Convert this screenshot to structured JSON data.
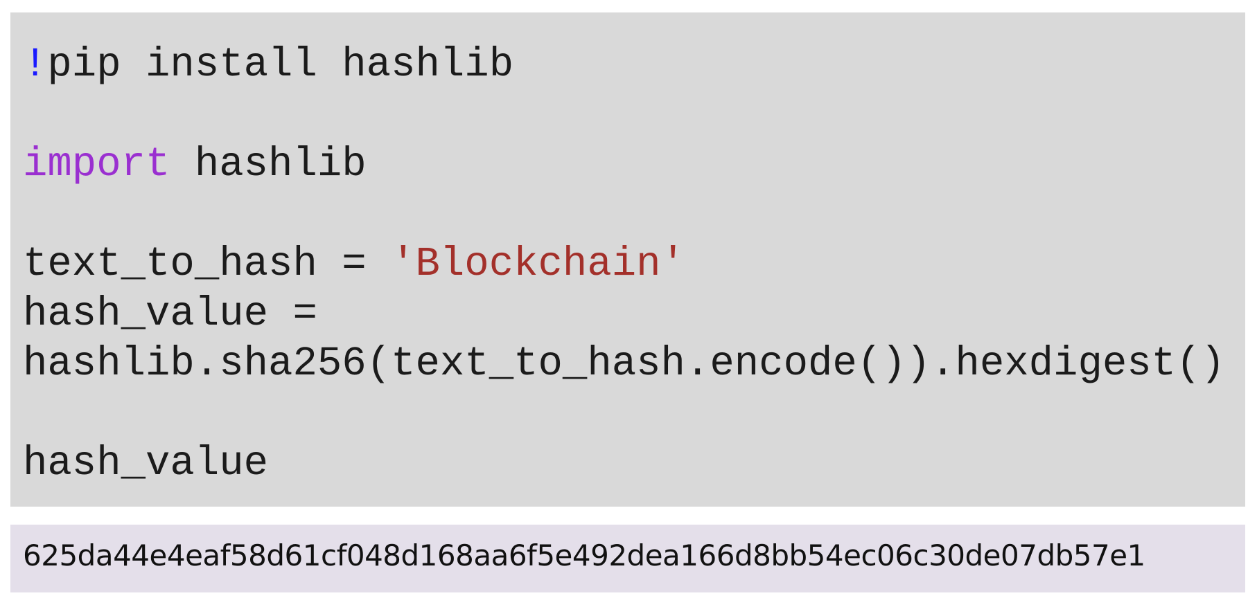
{
  "code_cell": {
    "line1_bang": "!",
    "line1_rest": "pip install hashlib",
    "line2_keyword": "import",
    "line2_rest": " hashlib",
    "line3_lhs": "text_to_hash = ",
    "line3_string": "'Blockchain'",
    "line4": "hash_value =",
    "line5": "hashlib.sha256(text_to_hash.encode()).hexdigest()",
    "line6": "hash_value"
  },
  "output_cell": {
    "text": "625da44e4eaf58d61cf048d168aa6f5e492dea166d8bb54ec06c30de07db57e1"
  },
  "colors": {
    "code_background": "#d9d9d9",
    "output_background": "#e4dfea",
    "bang": "#1a1aff",
    "keyword": "#9a2fd0",
    "string": "#a3302a"
  }
}
